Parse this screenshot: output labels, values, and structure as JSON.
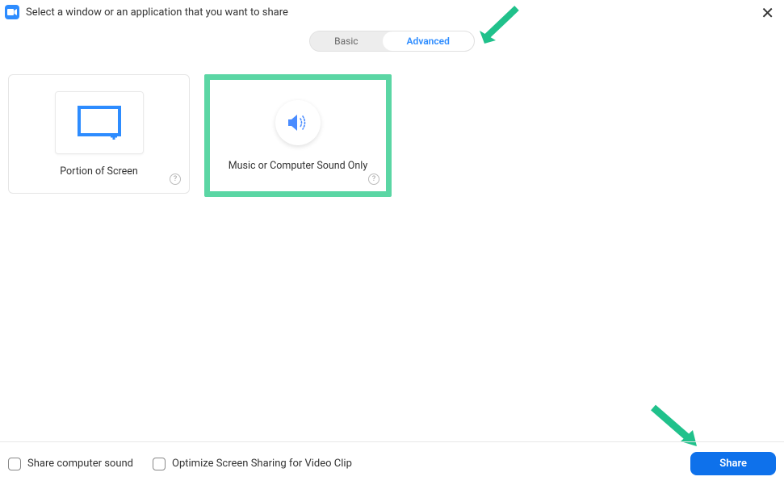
{
  "header": {
    "title": "Select a window or an application that you want to share"
  },
  "tabs": {
    "basic": "Basic",
    "advanced": "Advanced"
  },
  "options": {
    "portion": {
      "label": "Portion of Screen"
    },
    "sound": {
      "label": "Music or Computer Sound Only"
    }
  },
  "footer": {
    "shareSound": "Share computer sound",
    "optimizeVideo": "Optimize Screen Sharing for Video Clip",
    "shareButton": "Share"
  },
  "colors": {
    "accent": "#5bd6a4",
    "primary": "#2d8cff",
    "button": "#0e71eb"
  }
}
